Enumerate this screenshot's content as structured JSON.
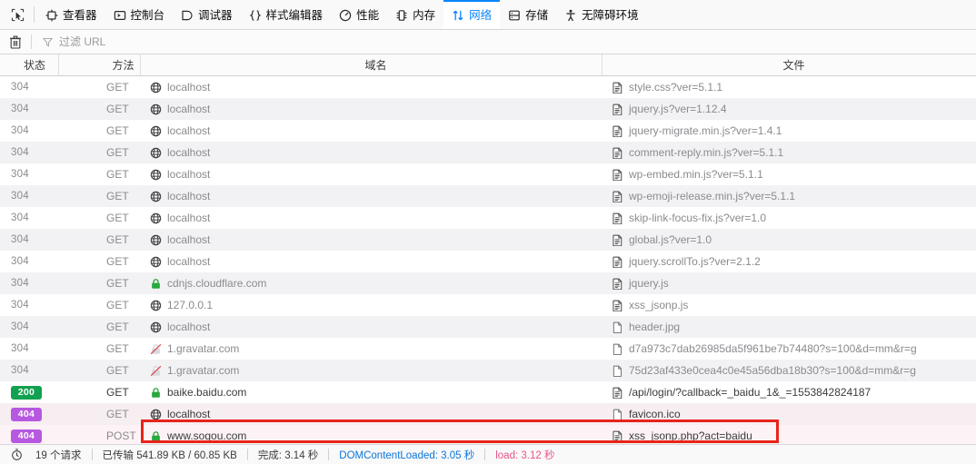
{
  "toolbar": {
    "picker_icon": "element-picker-icon",
    "tabs": [
      {
        "id": "inspector",
        "label": "查看器",
        "icon": "inspector-icon",
        "active": false
      },
      {
        "id": "console",
        "label": "控制台",
        "icon": "console-icon",
        "active": false
      },
      {
        "id": "debugger",
        "label": "调试器",
        "icon": "debugger-icon",
        "active": false
      },
      {
        "id": "style-editor",
        "label": "样式编辑器",
        "icon": "style-editor-icon",
        "active": false
      },
      {
        "id": "performance",
        "label": "性能",
        "icon": "performance-icon",
        "active": false
      },
      {
        "id": "memory",
        "label": "内存",
        "icon": "memory-icon",
        "active": false
      },
      {
        "id": "network",
        "label": "网络",
        "icon": "network-icon",
        "active": true
      },
      {
        "id": "storage",
        "label": "存储",
        "icon": "storage-icon",
        "active": false
      },
      {
        "id": "accessibility",
        "label": "无障碍环境",
        "icon": "accessibility-icon",
        "active": false
      }
    ],
    "active_tab_color": "#0a84ff"
  },
  "filterbar": {
    "clear_icon": "trash-icon",
    "filter_icon": "funnel-icon",
    "filter_placeholder": "过滤 URL",
    "filter_value": ""
  },
  "table": {
    "columns": [
      {
        "key": "status",
        "label": "状态"
      },
      {
        "key": "method",
        "label": "方法"
      },
      {
        "key": "domain",
        "label": "域名"
      },
      {
        "key": "file",
        "label": "文件"
      }
    ],
    "rows": [
      {
        "status": "304",
        "status_kind": "dim",
        "method": "GET",
        "domain": "localhost",
        "domain_icon": "globe-icon",
        "file": "style.css?ver=5.1.1",
        "file_icon": "document-icon"
      },
      {
        "status": "304",
        "status_kind": "dim",
        "method": "GET",
        "domain": "localhost",
        "domain_icon": "globe-icon",
        "file": "jquery.js?ver=1.12.4",
        "file_icon": "document-icon"
      },
      {
        "status": "304",
        "status_kind": "dim",
        "method": "GET",
        "domain": "localhost",
        "domain_icon": "globe-icon",
        "file": "jquery-migrate.min.js?ver=1.4.1",
        "file_icon": "document-icon"
      },
      {
        "status": "304",
        "status_kind": "dim",
        "method": "GET",
        "domain": "localhost",
        "domain_icon": "globe-icon",
        "file": "comment-reply.min.js?ver=5.1.1",
        "file_icon": "document-icon"
      },
      {
        "status": "304",
        "status_kind": "dim",
        "method": "GET",
        "domain": "localhost",
        "domain_icon": "globe-icon",
        "file": "wp-embed.min.js?ver=5.1.1",
        "file_icon": "document-icon"
      },
      {
        "status": "304",
        "status_kind": "dim",
        "method": "GET",
        "domain": "localhost",
        "domain_icon": "globe-icon",
        "file": "wp-emoji-release.min.js?ver=5.1.1",
        "file_icon": "document-icon"
      },
      {
        "status": "304",
        "status_kind": "dim",
        "method": "GET",
        "domain": "localhost",
        "domain_icon": "globe-icon",
        "file": "skip-link-focus-fix.js?ver=1.0",
        "file_icon": "document-icon"
      },
      {
        "status": "304",
        "status_kind": "dim",
        "method": "GET",
        "domain": "localhost",
        "domain_icon": "globe-icon",
        "file": "global.js?ver=1.0",
        "file_icon": "document-icon"
      },
      {
        "status": "304",
        "status_kind": "dim",
        "method": "GET",
        "domain": "localhost",
        "domain_icon": "globe-icon",
        "file": "jquery.scrollTo.js?ver=2.1.2",
        "file_icon": "document-icon"
      },
      {
        "status": "304",
        "status_kind": "dim",
        "method": "GET",
        "domain": "cdnjs.cloudflare.com",
        "domain_icon": "lock-icon",
        "file": "jquery.js",
        "file_icon": "document-icon"
      },
      {
        "status": "304",
        "status_kind": "dim",
        "method": "GET",
        "domain": "127.0.0.1",
        "domain_icon": "globe-icon",
        "file": "xss_jsonp.js",
        "file_icon": "document-icon"
      },
      {
        "status": "304",
        "status_kind": "dim",
        "method": "GET",
        "domain": "localhost",
        "domain_icon": "globe-icon",
        "file": "header.jpg",
        "file_icon": "blank-page-icon"
      },
      {
        "status": "304",
        "status_kind": "dim",
        "method": "GET",
        "domain": "1.gravatar.com",
        "domain_icon": "broken-lock-icon",
        "file": "d7a973c7dab26985da5f961be7b74480?s=100&d=mm&r=g",
        "file_icon": "blank-page-icon"
      },
      {
        "status": "304",
        "status_kind": "dim",
        "method": "GET",
        "domain": "1.gravatar.com",
        "domain_icon": "broken-lock-icon",
        "file": "75d23af433e0cea4c0e45a56dba18b30?s=100&d=mm&r=g",
        "file_icon": "blank-page-icon"
      },
      {
        "status": "200",
        "status_kind": "ok",
        "method": "GET",
        "domain": "baike.baidu.com",
        "domain_icon": "lock-icon",
        "file": "/api/login/?callback=_baidu_1&_=1553842824187",
        "file_icon": "document-icon"
      },
      {
        "status": "404",
        "status_kind": "notfound",
        "method": "GET",
        "domain": "localhost",
        "domain_icon": "globe-icon",
        "file": "favicon.ico",
        "file_icon": "blank-page-icon"
      },
      {
        "status": "404",
        "status_kind": "notfound",
        "method": "POST",
        "domain": "www.sogou.com",
        "domain_icon": "lock-icon",
        "file": "xss_jsonp.php?act=baidu",
        "file_icon": "document-icon"
      }
    ]
  },
  "annotation": {
    "color": "#e8241a",
    "shape": "rectangle",
    "target": "last-row-domain-and-file"
  },
  "statusbar": {
    "clock_icon": "stopwatch-icon",
    "requests": "19 个请求",
    "transferred": "已传输 541.89 KB / 60.85 KB",
    "finish": "完成: 3.14 秒",
    "domcontentloaded": "DOMContentLoaded: 3.05 秒",
    "load": "load: 3.12 秒",
    "domcontentloaded_color": "#0b76d8",
    "load_color": "#e8548a"
  }
}
